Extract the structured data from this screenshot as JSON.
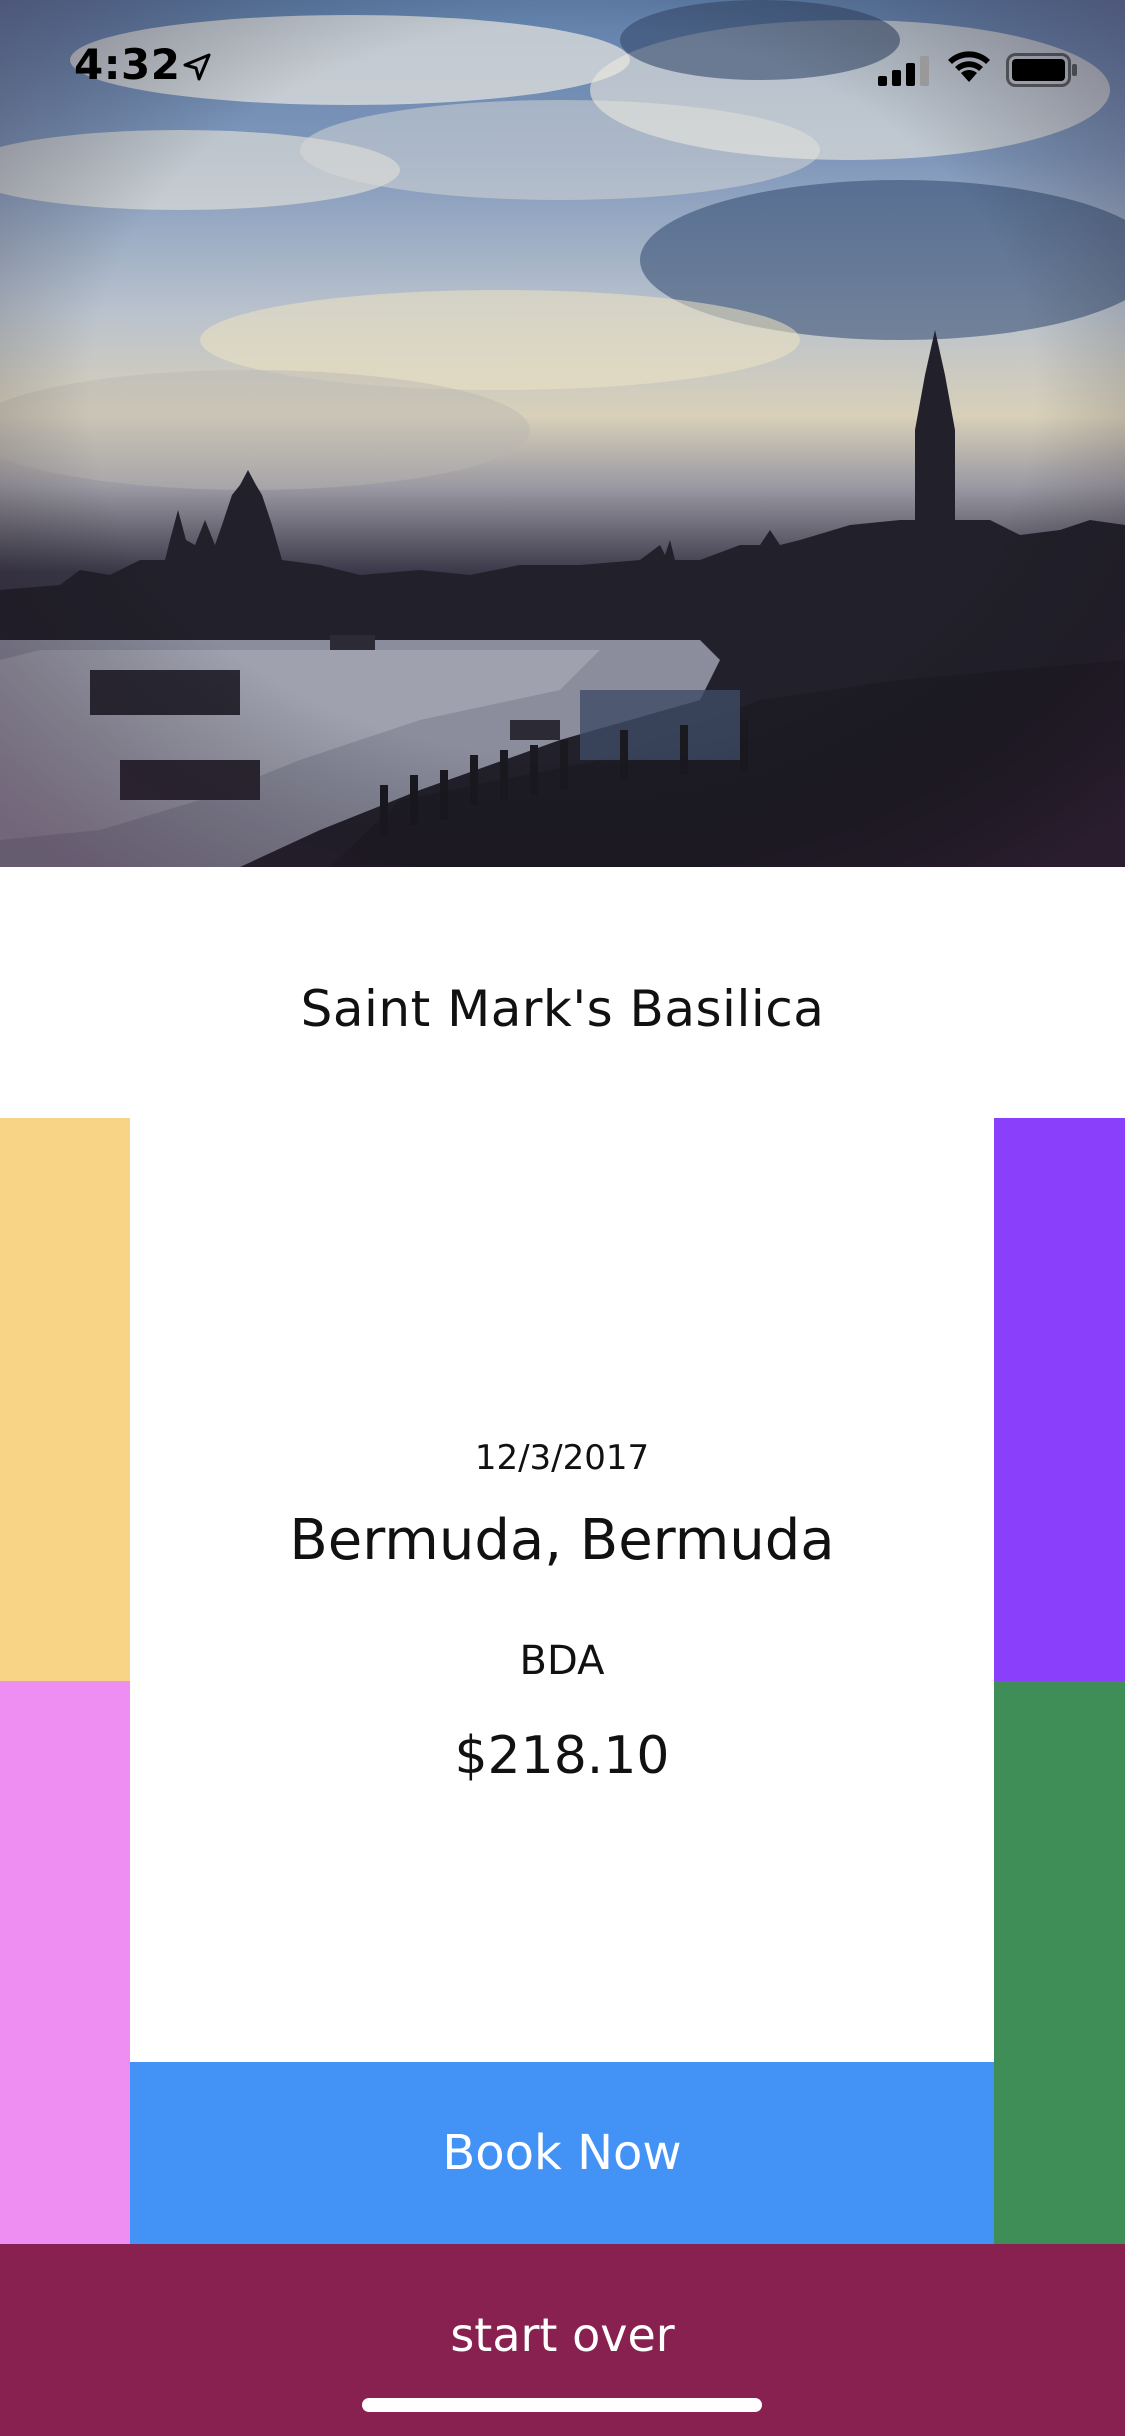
{
  "status_bar": {
    "time": "4:32",
    "location_icon": "location-arrow-icon",
    "signal_icon": "cellular-signal-icon",
    "wifi_icon": "wifi-icon",
    "battery_icon": "battery-icon"
  },
  "hero": {
    "image": "venice-skyline-sunset-photo"
  },
  "place": {
    "title": "Saint Mark's Basilica"
  },
  "flight": {
    "date": "12/3/2017",
    "destination": "Bermuda, Bermuda",
    "airport_code": "BDA",
    "price": "$218.10"
  },
  "actions": {
    "book_label": "Book Now",
    "start_over_label": "start over"
  },
  "colors": {
    "tile_top_left": "#f8d487",
    "tile_bottom_left": "#ef8ef2",
    "tile_top_right": "#8a3ffb",
    "tile_bottom_right": "#3f8e58",
    "book_button": "#4393f7",
    "start_over_bar": "#88214f"
  }
}
